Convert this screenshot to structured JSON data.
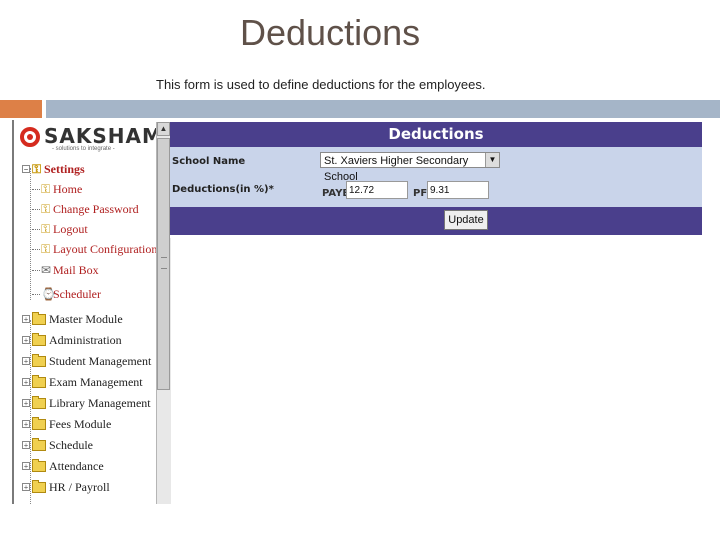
{
  "slide": {
    "title": "Deductions",
    "subtitle": "This form is used to define deductions for the employees."
  },
  "app": {
    "logo_text": "SAKSHAM",
    "logo_tagline": "- solutions to integrate -"
  },
  "sidebar": {
    "settings_label": "Settings",
    "settings_items": [
      {
        "label": "Home",
        "icon": "key-icon"
      },
      {
        "label": "Change Password",
        "icon": "key-icon"
      },
      {
        "label": "Logout",
        "icon": "key-icon"
      },
      {
        "label": "Layout Configuration",
        "icon": "key-icon"
      },
      {
        "label": "Mail Box",
        "icon": "mail-icon"
      },
      {
        "label": "Scheduler",
        "icon": "scheduler-icon"
      }
    ],
    "modules": [
      {
        "label": "Master Module"
      },
      {
        "label": "Administration"
      },
      {
        "label": "Student Management"
      },
      {
        "label": "Exam Management"
      },
      {
        "label": "Library Management"
      },
      {
        "label": "Fees Module"
      },
      {
        "label": "Schedule"
      },
      {
        "label": "Attendance"
      },
      {
        "label": "HR / Payroll"
      }
    ]
  },
  "panel": {
    "title": "Deductions",
    "school_label": "School Name",
    "school_value": "St. Xaviers Higher Secondary School",
    "deductions_label": "Deductions(in %)*",
    "paye_label": "PAYE",
    "paye_value": "12.72",
    "pf_label": "PF",
    "pf_value": "9.31",
    "update_label": "Update"
  },
  "colors": {
    "header_purple": "#4a3f8c",
    "form_bg": "#c9d4ea",
    "accent_orange": "#dd8047",
    "accent_blue": "#a5b5c8"
  }
}
